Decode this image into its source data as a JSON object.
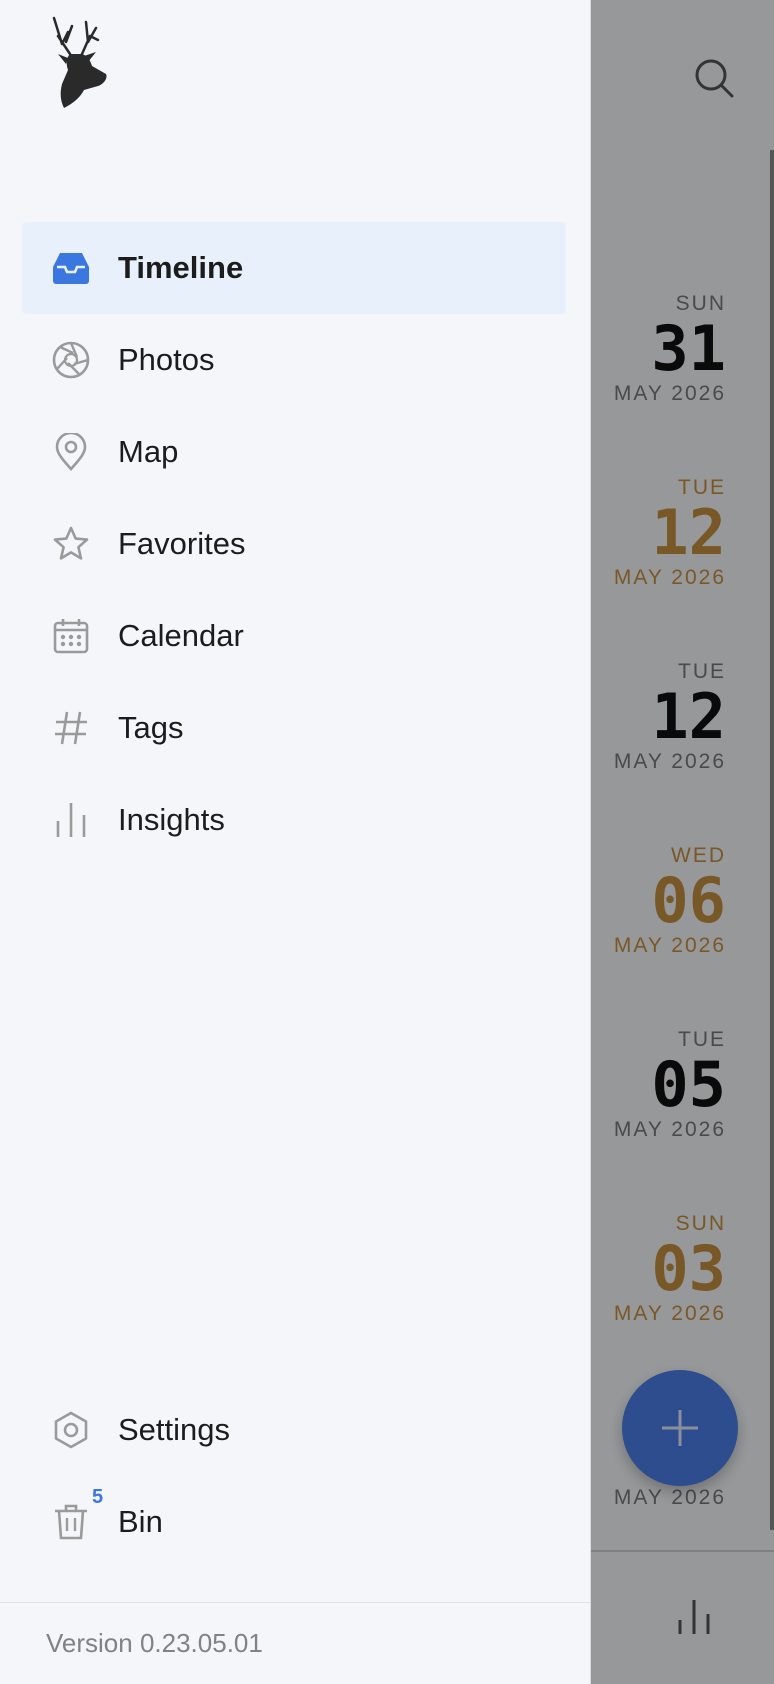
{
  "drawer": {
    "nav": [
      {
        "label": "Timeline",
        "icon": "inbox-icon",
        "active": true
      },
      {
        "label": "Photos",
        "icon": "aperture-icon"
      },
      {
        "label": "Map",
        "icon": "map-pin-icon"
      },
      {
        "label": "Favorites",
        "icon": "star-icon"
      },
      {
        "label": "Calendar",
        "icon": "calendar-icon"
      },
      {
        "label": "Tags",
        "icon": "hash-icon"
      },
      {
        "label": "Insights",
        "icon": "bar-chart-icon"
      }
    ],
    "bottom_nav": [
      {
        "label": "Settings",
        "icon": "settings-icon"
      },
      {
        "label": "Bin",
        "icon": "trash-icon",
        "badge": "5"
      }
    ],
    "version": "Version 0.23.05.01"
  },
  "timeline": {
    "entries": [
      {
        "dow": "SUN",
        "day": "31",
        "month_year": "MAY 2026",
        "highlighted": false
      },
      {
        "dow": "TUE",
        "day": "12",
        "month_year": "MAY 2026",
        "highlighted": true
      },
      {
        "dow": "TUE",
        "day": "12",
        "month_year": "MAY 2026",
        "highlighted": false
      },
      {
        "dow": "WED",
        "day": "06",
        "month_year": "MAY 2026",
        "highlighted": true
      },
      {
        "dow": "TUE",
        "day": "05",
        "month_year": "MAY 2026",
        "highlighted": false
      },
      {
        "dow": "SUN",
        "day": "03",
        "month_year": "MAY 2026",
        "highlighted": true
      },
      {
        "dow": "",
        "day": "",
        "month_year": "MAY 2026",
        "highlighted": false
      }
    ]
  },
  "colors": {
    "accent": "#3a78e0",
    "highlight_date": "#c48f3f",
    "active_nav_bg": "#e8f0fc"
  }
}
